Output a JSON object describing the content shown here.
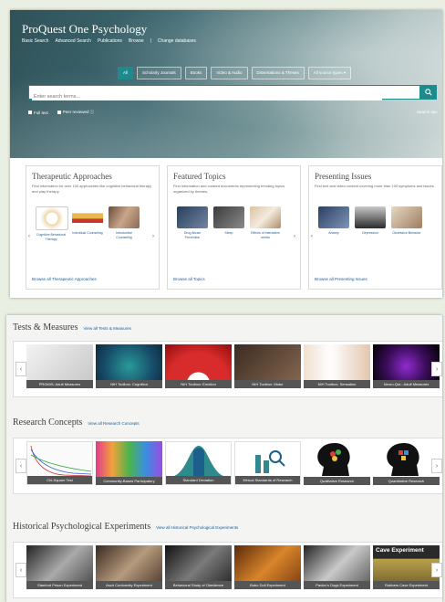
{
  "app": {
    "title": "ProQuest One Psychology"
  },
  "nav": [
    "Basic Search",
    "Advanced Search",
    "Publications",
    "Browse",
    "|",
    "Change databases"
  ],
  "filters": [
    "All",
    "Scholarly Journals",
    "Books",
    "Video & Audio",
    "Dissertations & Theses",
    "All source types ▾"
  ],
  "search": {
    "placeholder": "Enter search terms...",
    "button_icon": "search-icon",
    "full_text": "Full text",
    "peer_reviewed": "Peer reviewed",
    "tips": "Search tips"
  },
  "panels": [
    {
      "title": "Therapeutic Approaches",
      "desc": "Find information for over 100 approaches like cognitive behavioral therapy and play therapy.",
      "items": [
        "Cognitive Behavioral Therapy",
        "Individual Counseling",
        "Introductive Counseling"
      ],
      "link": "Browse all Therapeutic Approaches"
    },
    {
      "title": "Featured Topics",
      "desc": "Find information and curated documents representing trending topics organized by themes.",
      "items": [
        "Drug Abuse Prevention",
        "Sleep",
        "Effects of Interactive media"
      ],
      "link": "Browse all Topics"
    },
    {
      "title": "Presenting Issues",
      "desc": "Find text and video content covering more than 100 symptoms and issues.",
      "items": [
        "Anxiety",
        "Depression",
        "Obsessive Behavior"
      ],
      "link": "Browse all Presenting Issues"
    }
  ],
  "sections": [
    {
      "title": "Tests & Measures",
      "link": "View all Tests & Measures",
      "tiles": [
        "PROMIS: Adult Measures",
        "NIH Toolbox: Cognition",
        "NIH Toolbox: Emotion",
        "NIH Toolbox: Motor",
        "NIH Toolbox: Sensation",
        "Neuro-QoL: Adult Measures"
      ]
    },
    {
      "title": "Research Concepts",
      "link": "View all Research Concepts",
      "tiles": [
        "Chi-Square Test",
        "Community-Based Participatory",
        "Standard Deviation",
        "Ethical Standards of Research",
        "Qualitative Research",
        "Quantitative Research"
      ]
    },
    {
      "title": "Historical Psychological Experiments",
      "link": "View all Historical Psychological Experiments",
      "tiles": [
        "Stanford Prison Experiment",
        "Asch Conformity Experiment",
        "Behavioral Study of Obedience",
        "Bobo Doll Experiment",
        "Pavlov's Dogs Experiment",
        "Robbers Cave Experiment"
      ],
      "tile_overlay": "Cave Experiment"
    }
  ],
  "colors": {
    "accent": "#1d8a8c",
    "link": "#1f5a8f"
  }
}
